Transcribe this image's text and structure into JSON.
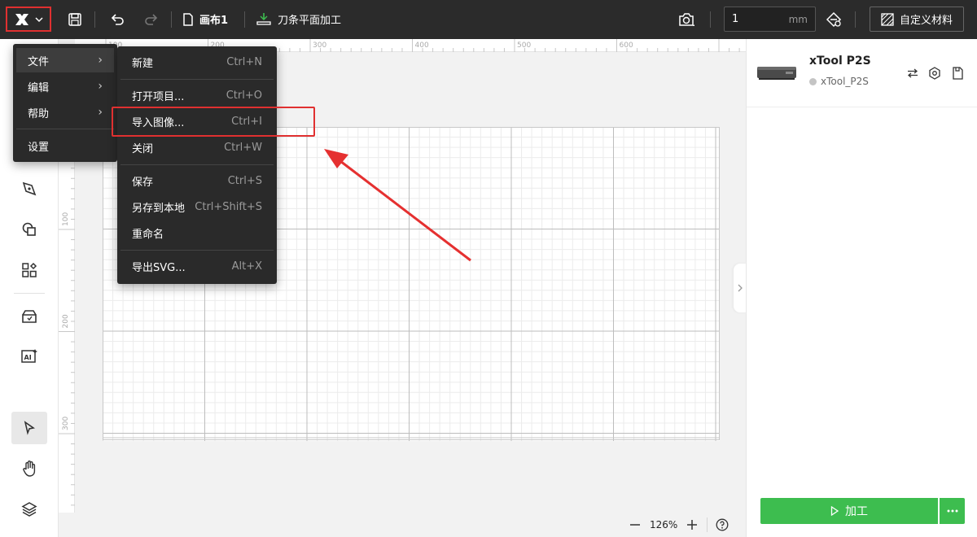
{
  "topbar": {
    "canvas_name": "画布1",
    "mode_name": "刀条平面加工",
    "thickness_value": "1",
    "thickness_unit": "mm",
    "material_label": "自定义材料"
  },
  "main_menu": {
    "items": [
      {
        "label": "文件"
      },
      {
        "label": "编辑"
      },
      {
        "label": "帮助"
      },
      {
        "label": "设置"
      }
    ]
  },
  "file_menu": {
    "items": [
      {
        "label": "新建",
        "shortcut": "Ctrl+N"
      },
      {
        "label": "打开项目...",
        "shortcut": "Ctrl+O"
      },
      {
        "label": "导入图像...",
        "shortcut": "Ctrl+I"
      },
      {
        "label": "关闭",
        "shortcut": "Ctrl+W"
      },
      {
        "label": "保存",
        "shortcut": "Ctrl+S"
      },
      {
        "label": "另存到本地",
        "shortcut": "Ctrl+Shift+S"
      },
      {
        "label": "重命名",
        "shortcut": ""
      },
      {
        "label": "导出SVG...",
        "shortcut": "Alt+X"
      }
    ]
  },
  "rulers": {
    "top_ticks": [
      "100",
      "200",
      "300",
      "400",
      "500",
      "600"
    ],
    "left_ticks": [
      "100",
      "200",
      "300"
    ]
  },
  "zoom": {
    "level": "126%"
  },
  "device": {
    "name": "xTool P2S",
    "status_label": "xTool_P2S"
  },
  "process": {
    "label": "加工"
  },
  "colors": {
    "accent_green": "#3dbd4f",
    "highlight_red": "#e03030",
    "topbar_bg": "#2b2b2b"
  }
}
